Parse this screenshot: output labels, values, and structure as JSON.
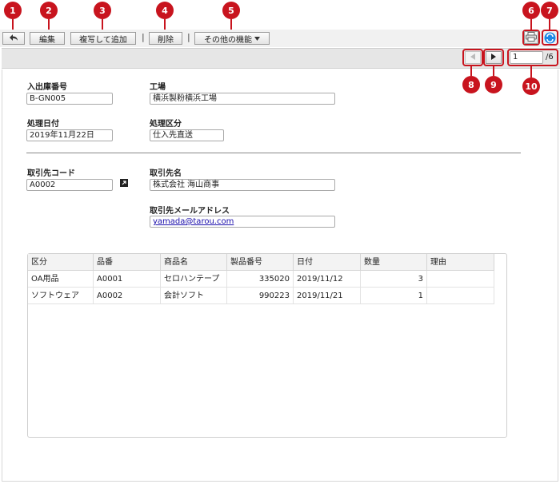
{
  "callouts": [
    "1",
    "2",
    "3",
    "4",
    "5",
    "6",
    "7",
    "8",
    "9",
    "10"
  ],
  "toolbar": {
    "edit_label": "編集",
    "copy_add_label": "複写して追加",
    "delete_label": "削除",
    "more_label": "その他の機能",
    "separator": "|"
  },
  "pager": {
    "current": "1",
    "total": "/6"
  },
  "form": {
    "slip_no_label": "入出庫番号",
    "slip_no_value": "B-GN005",
    "factory_label": "工場",
    "factory_value": "横浜製粉横浜工場",
    "date_label": "処理日付",
    "date_value": "2019年11月22日",
    "type_label": "処理区分",
    "type_value": "仕入先直送",
    "client_code_label": "取引先コード",
    "client_code_value": "A0002",
    "client_name_label": "取引先名",
    "client_name_value": "株式会社 海山商事",
    "email_label": "取引先メールアドレス",
    "email_value": "yamada@tarou.com"
  },
  "table": {
    "headers": [
      "区分",
      "品番",
      "商品名",
      "製品番号",
      "日付",
      "数量",
      "理由"
    ],
    "rows": [
      [
        "OA用品",
        "A0001",
        "セロハンテープ",
        "335020",
        "2019/11/12",
        "3",
        ""
      ],
      [
        "ソフトウェア",
        "A0002",
        "会計ソフト",
        "990223",
        "2019/11/21",
        "1",
        ""
      ]
    ]
  },
  "colors": {
    "callout": "#c8141e",
    "link": "#1a0dab",
    "accent_icon": "#1e88e5"
  }
}
